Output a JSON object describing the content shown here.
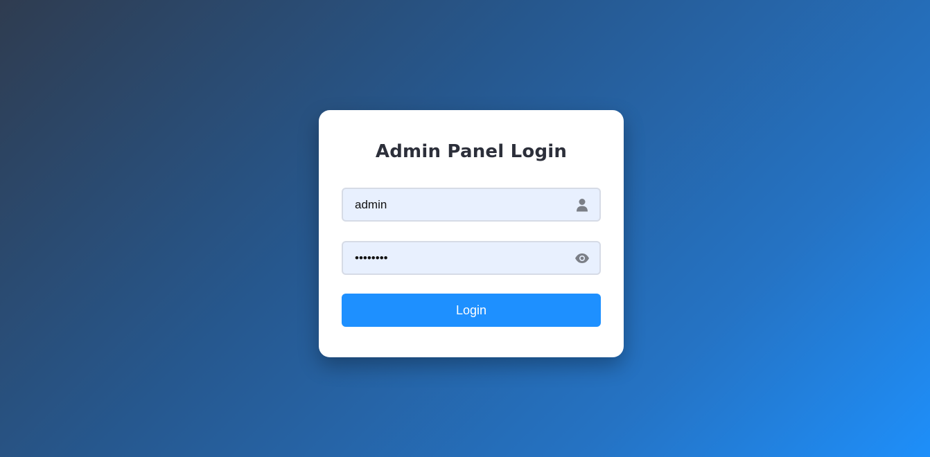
{
  "page": {
    "background_colors": [
      "#2f3c50",
      "#1e8ffa"
    ]
  },
  "login_card": {
    "title": "Admin Panel Login",
    "username": {
      "value": "admin",
      "icon": "user-icon"
    },
    "password": {
      "value": "••••••••",
      "icon": "eye-icon"
    },
    "login_button": {
      "label": "Login",
      "color": "#1e90ff"
    }
  }
}
